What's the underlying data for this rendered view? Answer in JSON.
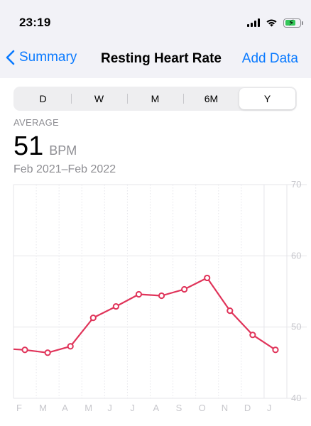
{
  "status_bar": {
    "time": "23:19"
  },
  "nav": {
    "back_label": "Summary",
    "title": "Resting Heart Rate",
    "action_label": "Add Data"
  },
  "segments": [
    {
      "label": "D",
      "selected": false
    },
    {
      "label": "W",
      "selected": false
    },
    {
      "label": "M",
      "selected": false
    },
    {
      "label": "6M",
      "selected": false
    },
    {
      "label": "Y",
      "selected": true
    }
  ],
  "summary": {
    "label": "AVERAGE",
    "value": "51",
    "unit": "BPM",
    "range": "Feb 2021–Feb 2022"
  },
  "colors": {
    "accent": "#0a7aff",
    "series": "#e0345a",
    "grid": "#e5e5ea",
    "axis_text": "#c7c7cc"
  },
  "chart_data": {
    "type": "line",
    "categories": [
      "F",
      "M",
      "A",
      "M",
      "J",
      "J",
      "A",
      "S",
      "O",
      "N",
      "D",
      "J"
    ],
    "values": [
      46.8,
      46.4,
      47.3,
      51.3,
      52.9,
      54.6,
      54.4,
      55.3,
      56.9,
      52.3,
      48.9,
      46.8
    ],
    "carry_in_value": 46.9,
    "ylim": [
      40,
      70
    ],
    "yticks": [
      40,
      50,
      60,
      70
    ],
    "title": "",
    "xlabel": "",
    "ylabel": "",
    "grid": true
  }
}
